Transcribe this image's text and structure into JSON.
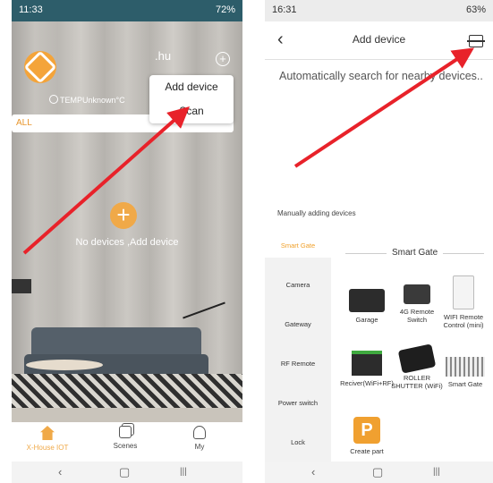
{
  "left_phone": {
    "status": {
      "time": "11:33",
      "icons": "72%"
    },
    "header": {
      "home_name": ".hu",
      "weather": "TEMPUnknown°C"
    },
    "filter": {
      "label": "ALL",
      "more": "···"
    },
    "popup_menu": {
      "items": [
        "Add device",
        "Scan"
      ]
    },
    "empty_state": {
      "message": "No devices ,Add device"
    },
    "tabs": [
      {
        "label": "X-House IOT",
        "icon": "house-icon",
        "active": true
      },
      {
        "label": "Scenes",
        "icon": "scenes-icon"
      },
      {
        "label": "My",
        "icon": "person-icon"
      }
    ],
    "nav": {
      "back": "‹",
      "home": "▢",
      "recents": "|||"
    },
    "accent": "#f0a948"
  },
  "right_phone": {
    "status": {
      "time": "16:31",
      "icons": "63%"
    },
    "header": {
      "back": "‹",
      "title": "Add device"
    },
    "auto_search_text": "Automatically search for nearby devices..",
    "manual_label": "Manually adding devices",
    "categories": [
      "Smart Gate",
      "Camera",
      "Gateway",
      "RF Remote",
      "Power switch",
      "Lock"
    ],
    "active_category": "Smart Gate",
    "panel_title": "Smart Gate",
    "devices": [
      {
        "label": "Garage",
        "icon": "garage-controller-icon"
      },
      {
        "label": "4G Remote Switch",
        "icon": "4g-switch-icon"
      },
      {
        "label": "WIFI Remote Control (mini)",
        "icon": "wifi-remote-icon"
      },
      {
        "label": "Reciver(WiFi+RF)",
        "icon": "receiver-icon"
      },
      {
        "label": "ROLLER SHUTTER (WiFi)",
        "icon": "roller-shutter-icon"
      },
      {
        "label": "Smart Gate",
        "icon": "gate-icon"
      },
      {
        "label": "Create part",
        "icon": "parking-icon"
      }
    ],
    "nav": {
      "back": "‹",
      "home": "▢",
      "recents": "|||"
    },
    "accent": "#f0a02a"
  },
  "annotation_color": "#e8222a"
}
